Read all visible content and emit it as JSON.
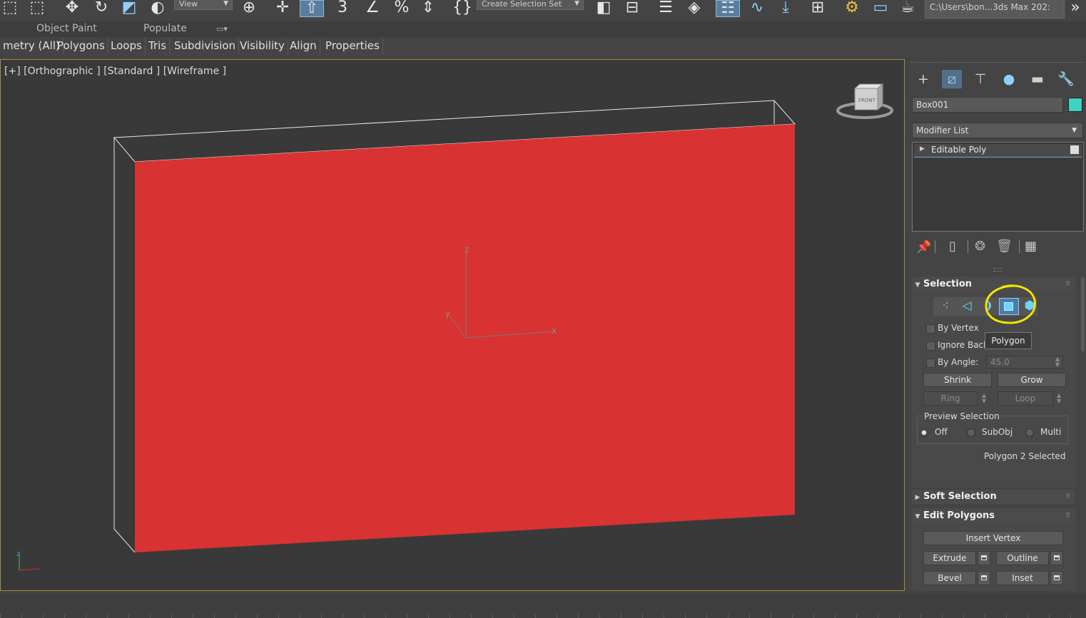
{
  "toolbar": {
    "view_dropdown": "View",
    "selection_set_dropdown": "Create Selection Set",
    "project_path": "C:\\Users\\bon...3ds Max 202:",
    "icons": [
      "select-region-icon",
      "window-crossing-icon",
      "move-icon",
      "rotate-icon",
      "scale-icon",
      "selection-filter-icon",
      "pivot-icon",
      "manipulate-icon",
      "keyboard-shortcut-icon",
      "snap-3d-icon",
      "angle-snap-icon",
      "percent-snap-icon",
      "spinner-snap-icon",
      "edit-named-sets-icon",
      "mirror-icon",
      "align-icon",
      "toggle-scene-explorer-icon",
      "toggle-layer-explorer-icon",
      "toggle-ribbon-icon",
      "curve-editor-icon",
      "schematic-view-icon",
      "material-editor-icon",
      "render-setup-icon",
      "rendered-frame-icon",
      "render-icon",
      "expand-icon"
    ]
  },
  "ribbon": {
    "top_tabs": [
      "Object Paint",
      "Populate"
    ],
    "tabs": [
      "metry (All)",
      "Polygons",
      "Loops",
      "Tris",
      "Subdivision",
      "Visibility",
      "Align",
      "Properties"
    ]
  },
  "viewport": {
    "label": "[+] [Orthographic ] [Standard ] [Wireframe ]",
    "gizmo": {
      "x": "x",
      "y": "y",
      "z": "z"
    },
    "viewcube_face": "FRONT",
    "face_color": "#d93232",
    "border_color": "#a88e37"
  },
  "command_panel": {
    "object_name": "Box001",
    "object_color": "#3fd1c2",
    "modifier_list": "Modifier List",
    "stack_item": "Editable Poly",
    "selection": {
      "title": "Selection",
      "by_vertex": "By Vertex",
      "ignore_backfacing": "Ignore Back",
      "by_angle": "By Angle:",
      "angle_value": "45.0",
      "shrink": "Shrink",
      "grow": "Grow",
      "ring": "Ring",
      "loop": "Loop",
      "preview_title": "Preview Selection",
      "preview_off": "Off",
      "preview_subobj": "SubObj",
      "preview_multi": "Multi",
      "status": "Polygon 2 Selected",
      "tooltip": "Polygon"
    },
    "soft_selection": "Soft Selection",
    "edit_polygons": {
      "title": "Edit Polygons",
      "insert_vertex": "Insert Vertex",
      "extrude": "Extrude",
      "outline": "Outline",
      "bevel": "Bevel",
      "inset": "Inset"
    }
  },
  "colors": {
    "accent": "#4aa3d8",
    "highlight_circle": "#f2e600"
  }
}
